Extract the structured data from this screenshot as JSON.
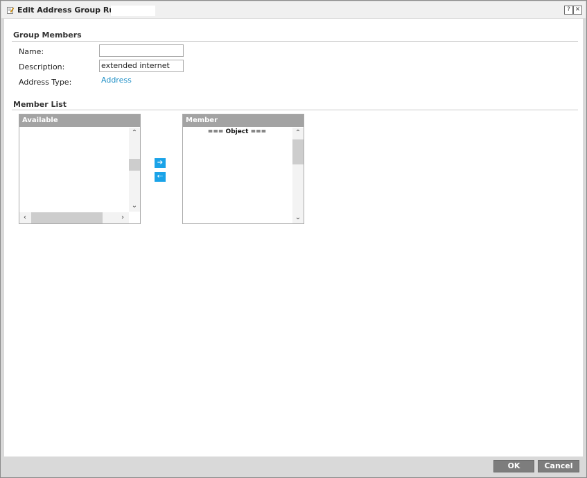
{
  "window": {
    "title": "Edit Address Group Rule",
    "help_glyph": "?",
    "close_glyph": "✕"
  },
  "group_members": {
    "section_title": "Group Members",
    "name_label": "Name:",
    "name_value": "",
    "description_label": "Description:",
    "description_value": "extended internet",
    "address_type_label": "Address Type:",
    "address_type_value": "Address"
  },
  "member_list": {
    "section_title": "Member List",
    "available": {
      "header": "Available",
      "items": []
    },
    "member": {
      "header": "Member",
      "items": [
        "=== Object ==="
      ]
    },
    "add_glyph": "➔",
    "remove_glyph": "⇠"
  },
  "footer": {
    "ok_label": "OK",
    "cancel_label": "Cancel"
  },
  "colors": {
    "accent": "#1aa3e8",
    "link": "#1e8fc6",
    "header_gray": "#a3a3a3",
    "button_gray": "#7d7d7d"
  }
}
